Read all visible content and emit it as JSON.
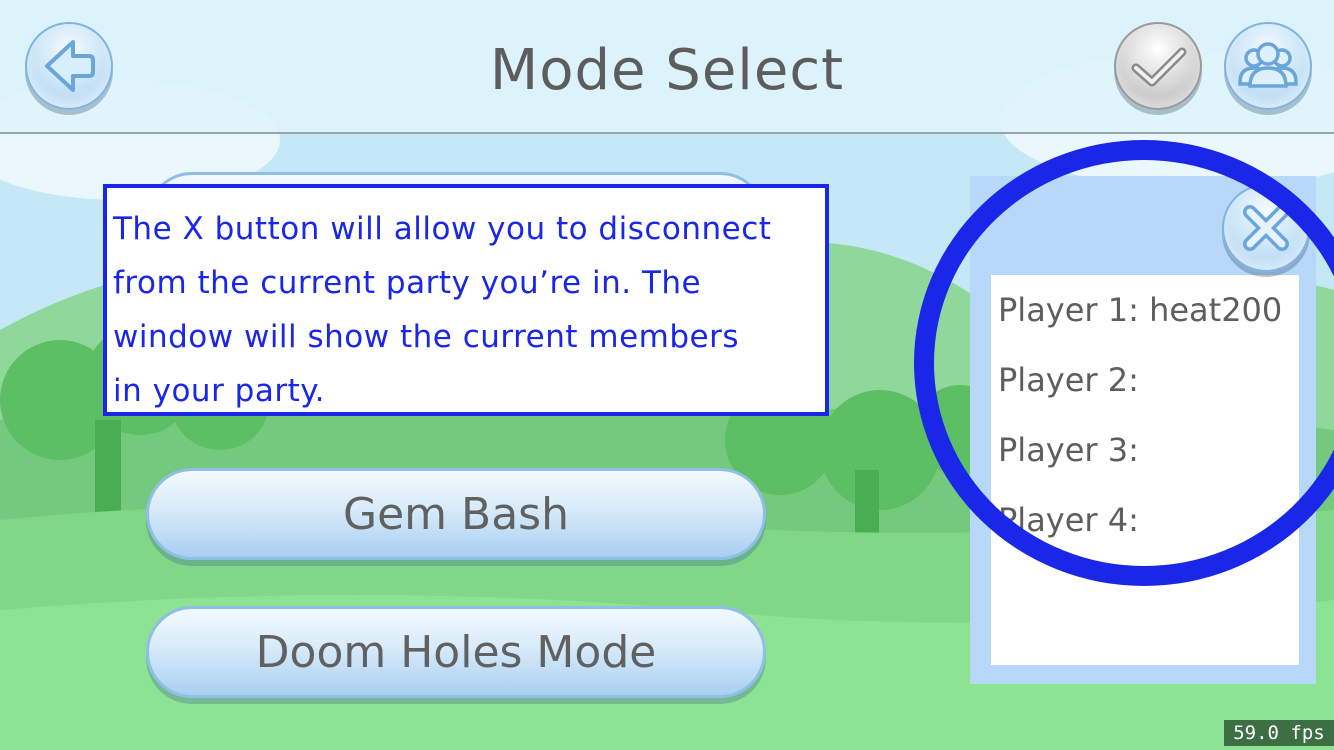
{
  "header": {
    "title": "Mode Select"
  },
  "buttons": {
    "back_icon": "back-arrow-icon",
    "confirm_icon": "checkmark-icon",
    "party_icon": "group-icon",
    "close_icon": "close-x-icon"
  },
  "modes": [
    {
      "label": ""
    },
    {
      "label": "Gem Bash"
    },
    {
      "label": "Doom Holes Mode"
    }
  ],
  "tutorial": {
    "lines": [
      "The X button will allow you to disconnect",
      "from the current party you’re in. The",
      "window will show the current members",
      "in your party."
    ]
  },
  "party": {
    "players": [
      "Player 1: heat200",
      "Player 2:",
      "Player 3:",
      "Player 4:"
    ]
  },
  "status": {
    "fps": "59.0 fps"
  },
  "colors": {
    "highlight": "#1a26e8",
    "panel": "#b7d8f8"
  }
}
